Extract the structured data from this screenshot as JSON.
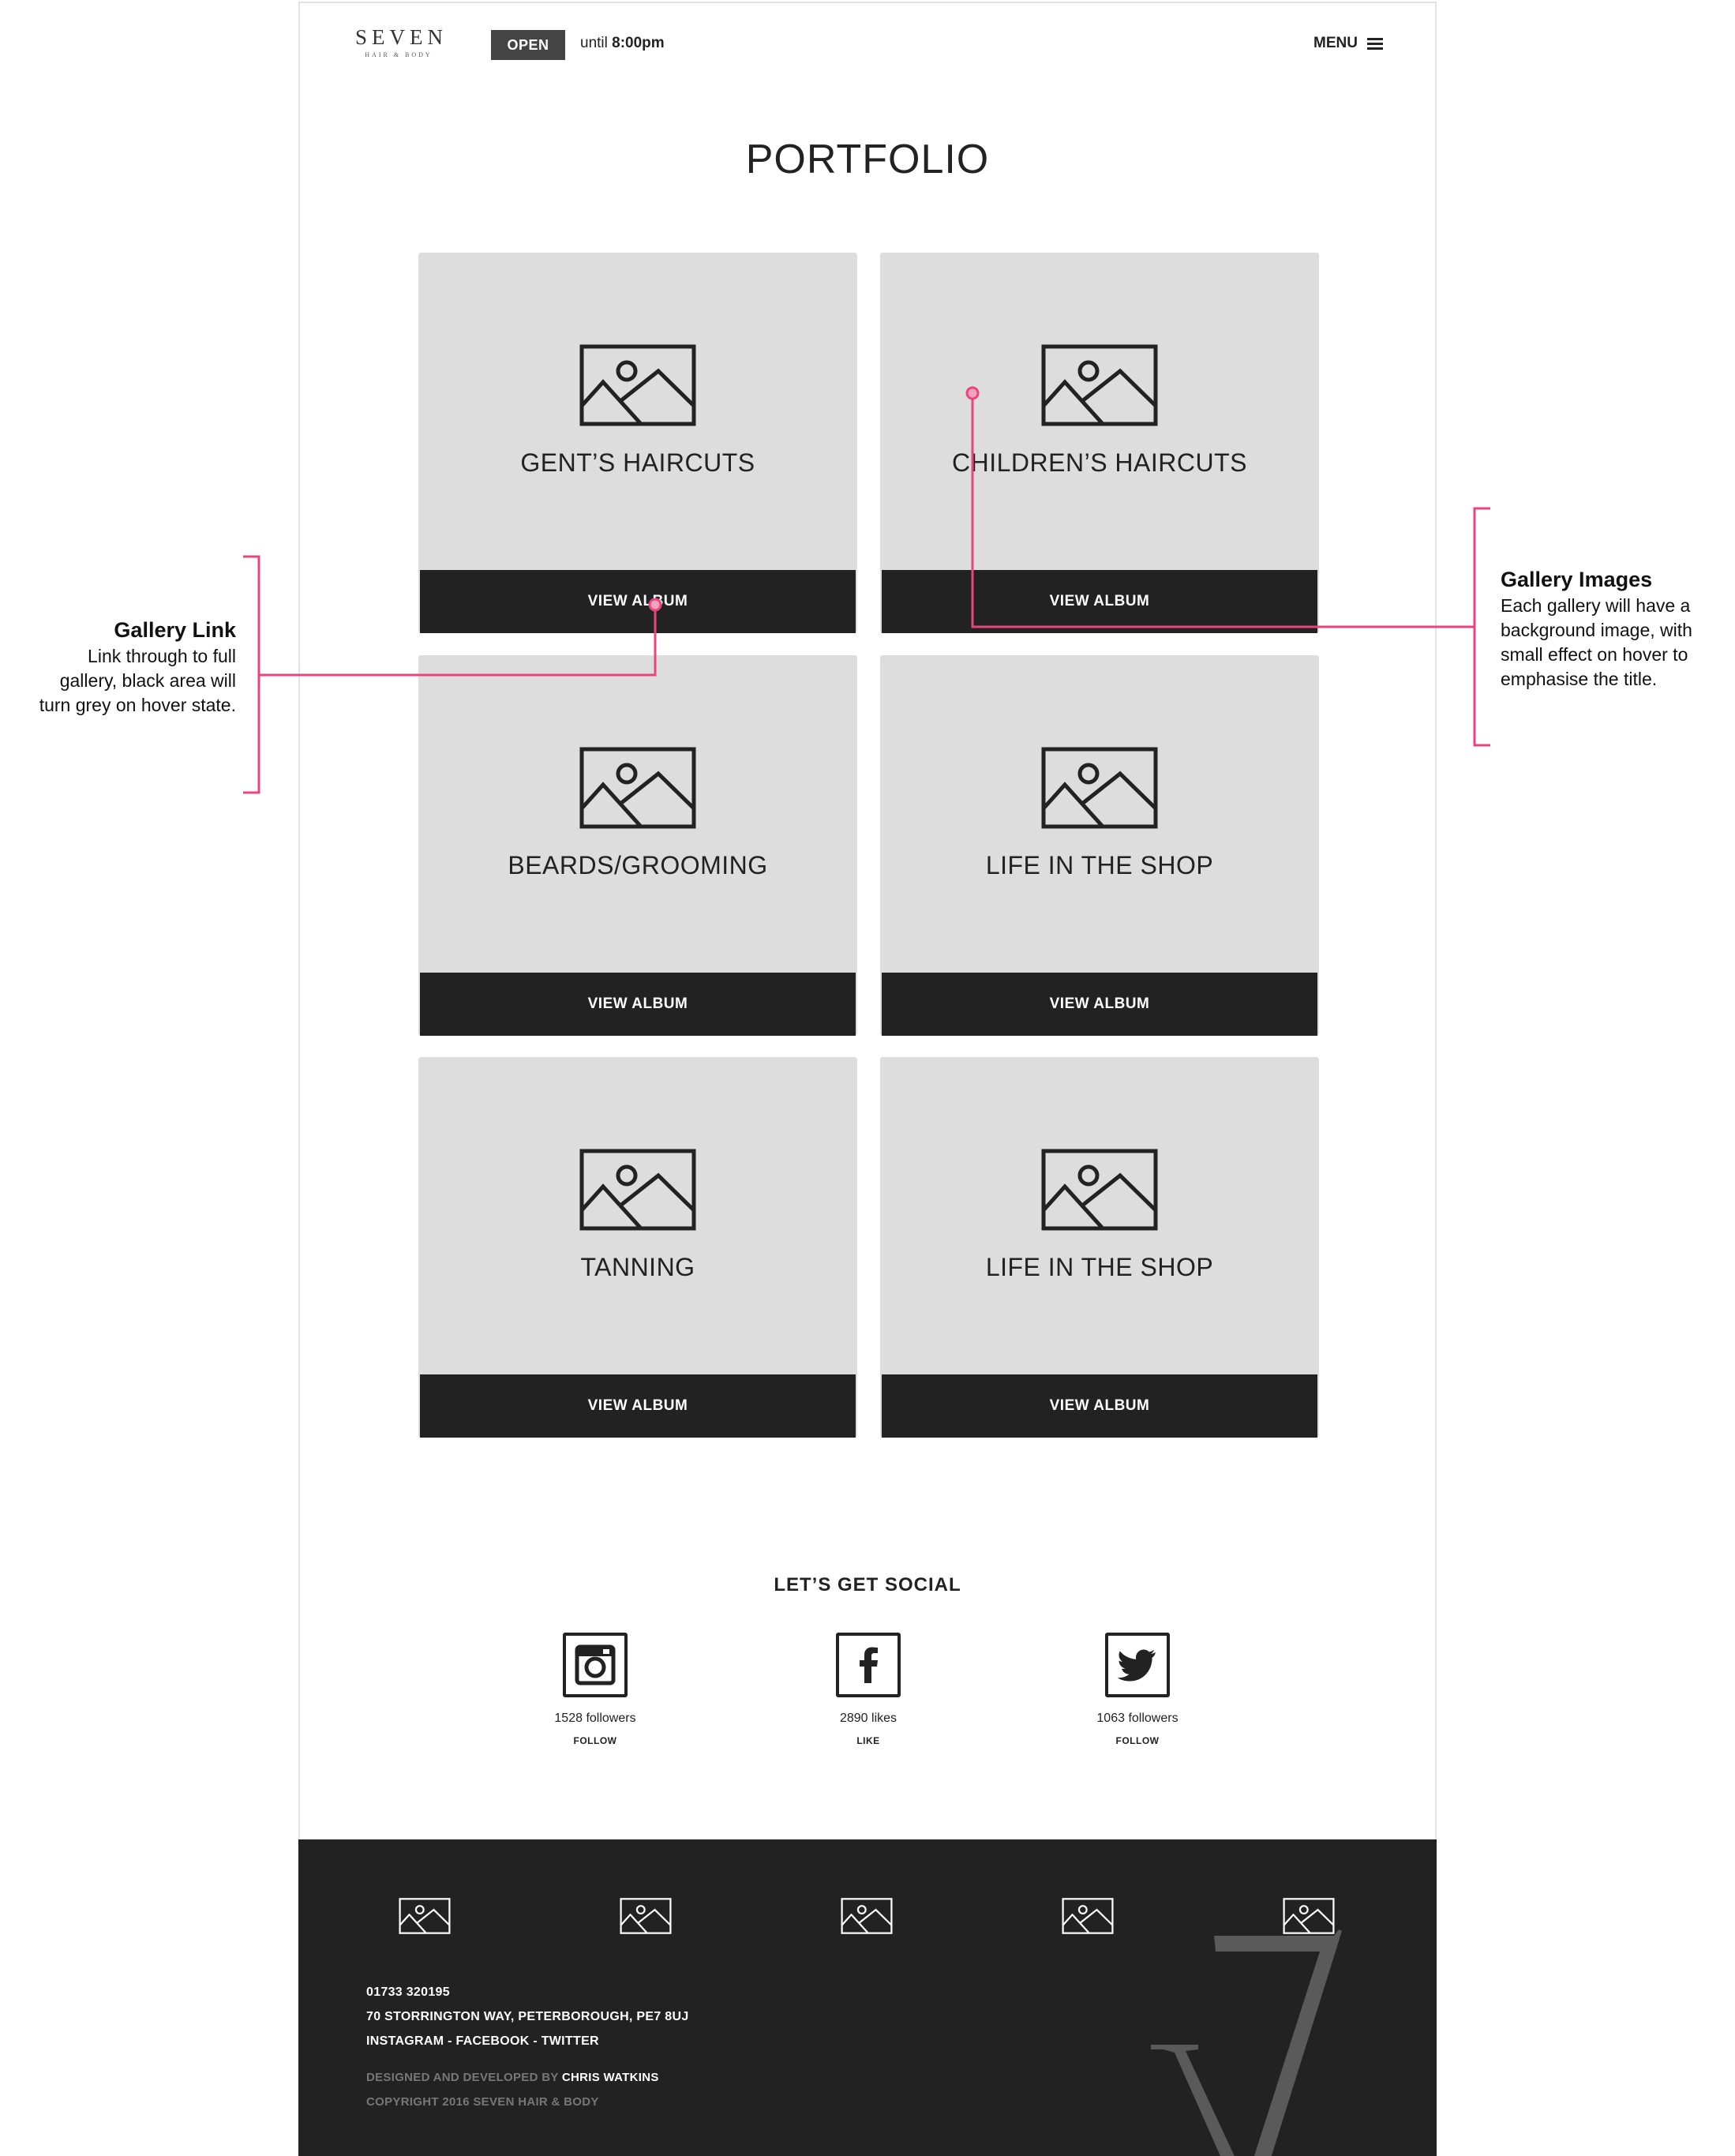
{
  "header": {
    "logo_text": "SEVEN",
    "logo_sub": "HAIR & BODY",
    "open_badge": "OPEN",
    "hours_prefix": "until ",
    "hours_time": "8:00pm",
    "menu_label": "MENU"
  },
  "page_title": "PORTFOLIO",
  "galleries": [
    {
      "title": "GENT’S HAIRCUTS",
      "button": "VIEW ALBUM"
    },
    {
      "title": "CHILDREN’S HAIRCUTS",
      "button": "VIEW ALBUM"
    },
    {
      "title": "BEARDS/GROOMING",
      "button": "VIEW ALBUM"
    },
    {
      "title": "LIFE IN THE SHOP",
      "button": "VIEW ALBUM"
    },
    {
      "title": "TANNING",
      "button": "VIEW ALBUM"
    },
    {
      "title": "LIFE IN THE SHOP",
      "button": "VIEW ALBUM"
    }
  ],
  "social": {
    "title": "LET’S GET SOCIAL",
    "items": [
      {
        "icon": "instagram-icon",
        "count": "1528 followers",
        "action": "FOLLOW"
      },
      {
        "icon": "facebook-icon",
        "count": "2890 likes",
        "action": "LIKE"
      },
      {
        "icon": "twitter-icon",
        "count": "1063 followers",
        "action": "FOLLOW"
      }
    ]
  },
  "footer": {
    "phone": "01733 320195",
    "address": "70 STORRINGTON WAY, PETERBOROUGH, PE7 8UJ",
    "social_links": "INSTAGRAM - FACEBOOK - TWITTER",
    "credit_prefix": "DESIGNED AND DEVELOPED BY ",
    "credit_author": "CHRIS WATKINS",
    "copyright": "COPYRIGHT 2016 SEVEN HAIR & BODY",
    "thumbnail_icon": "image-placeholder-icon",
    "watermark": "7"
  },
  "annotations": {
    "gallery_link": {
      "title": "Gallery Link",
      "lines": [
        "Link through to full",
        "gallery, black area will",
        "turn grey on hover state."
      ]
    },
    "gallery_images": {
      "title": "Gallery Images",
      "lines": [
        "Each gallery will have a",
        "background image, with",
        "small effect on hover to",
        "emphasise the title."
      ]
    }
  },
  "colors": {
    "annotation": "#e8457d",
    "card_bg": "#dddddd",
    "dark": "#222222",
    "badge": "#444444"
  }
}
